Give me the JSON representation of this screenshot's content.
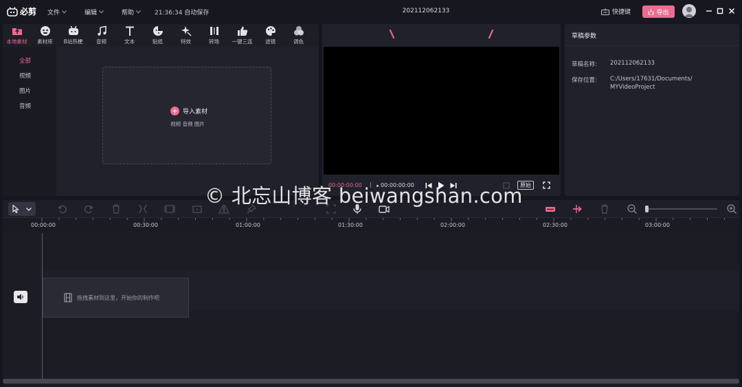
{
  "app": {
    "name": "必剪",
    "project_title": "202112062133"
  },
  "menu": {
    "file": "文件",
    "edit": "编辑",
    "help": "帮助"
  },
  "autosave": "21:36:34 自动保存",
  "header": {
    "shortcut": "快捷键",
    "export": "导出"
  },
  "tabs": [
    {
      "label": "本地素材",
      "icon": "upload-folder-icon",
      "active": true
    },
    {
      "label": "素材库",
      "icon": "face-icon"
    },
    {
      "label": "B站热梗",
      "icon": "tv-icon"
    },
    {
      "label": "音频",
      "icon": "music-note-icon"
    },
    {
      "label": "文本",
      "icon": "text-t-icon"
    },
    {
      "label": "贴纸",
      "icon": "sticker-icon"
    },
    {
      "label": "特效",
      "icon": "sparkle-icon"
    },
    {
      "label": "转场",
      "icon": "transition-icon"
    },
    {
      "label": "一键三连",
      "icon": "thumbs-up-icon"
    },
    {
      "label": "滤镜",
      "icon": "palette-icon"
    },
    {
      "label": "调色",
      "icon": "color-circles-icon"
    }
  ],
  "sidebar": {
    "items": [
      "全部",
      "视频",
      "图片",
      "音频"
    ]
  },
  "media": {
    "import_label": "导入素材",
    "import_sub": "视频 音频 图片"
  },
  "preview": {
    "current_time": "00:00:00:00",
    "total_time": "00:00:00:00",
    "ratio": "原始"
  },
  "params": {
    "title": "草稿参数",
    "name_label": "草稿名称:",
    "name_value": "202112062133",
    "path_label": "保存位置:",
    "path_value_1": "C:/Users/17631/Documents/",
    "path_value_2": "MYVideoProject"
  },
  "timeline": {
    "ticks": [
      "00:00:00",
      "00:30:00",
      "01:00:00",
      "01:30:00",
      "02:00:00",
      "02:30:00",
      "03:00:00"
    ],
    "drop_hint": "拖拽素材到这里，开始你的制作吧"
  },
  "watermark": "© 北忘山博客 beiwangshan.com",
  "colors": {
    "accent": "#ec6c8f",
    "background": "#16161e",
    "panel": "#21212b"
  }
}
